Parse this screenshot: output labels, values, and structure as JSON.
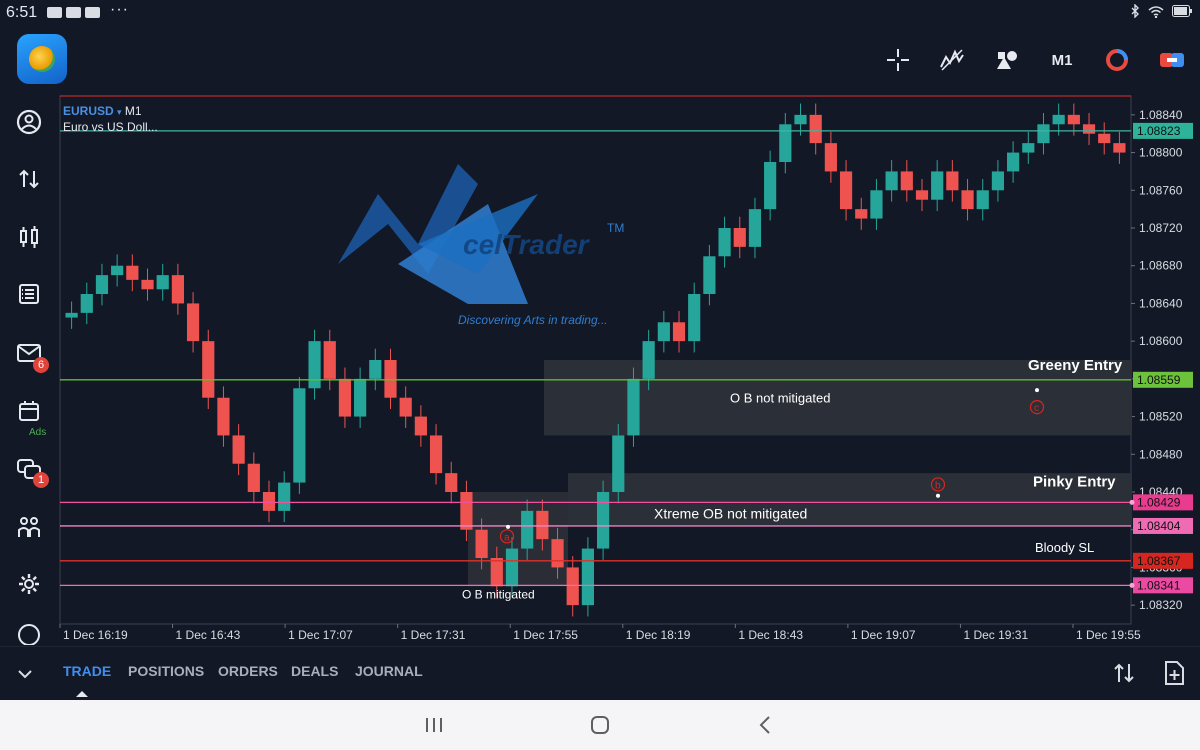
{
  "status_bar": {
    "time": "6:51",
    "dots": "···"
  },
  "toolbar": {
    "timeframe": "M1"
  },
  "sidebar": {
    "mail_badge": "6",
    "chat_badge": "1",
    "ads_label": "Ads"
  },
  "chart": {
    "symbol": "EURUSD",
    "symbol_suffix": "▾",
    "timeframe": "M1",
    "description": "Euro vs US Doll...",
    "watermark": {
      "text": "celTrader",
      "tm": "TM",
      "tagline": "Discovering Arts in trading..."
    },
    "price_labels": [
      "1.08840",
      "1.08800",
      "1.08760",
      "1.08720",
      "1.08680",
      "1.08640",
      "1.08600",
      "1.08560",
      "1.08520",
      "1.08480",
      "1.08440",
      "1.08400",
      "1.08360",
      "1.08320"
    ],
    "time_labels": [
      "1 Dec 16:19",
      "1 Dec 16:43",
      "1 Dec 17:07",
      "1 Dec 17:31",
      "1 Dec 17:55",
      "1 Dec 18:19",
      "1 Dec 18:43",
      "1 Dec 19:07",
      "1 Dec 19:31",
      "1 Dec 19:55"
    ],
    "lines": [
      {
        "name": "current-price",
        "price": "1.08823",
        "color": "#3fb5a0",
        "label_bg": "#2eb39b"
      },
      {
        "name": "greeny-entry",
        "price": "1.08559",
        "color": "#5fbf2c",
        "label_bg": "#6cc23a"
      },
      {
        "name": "line-08429",
        "price": "1.08429",
        "color": "#f24fa0",
        "label_bg": "#e93b8f"
      },
      {
        "name": "line-08404",
        "price": "1.08404",
        "color": "#ef85c4",
        "label_bg": "#ef6cb5"
      },
      {
        "name": "bloody-sl",
        "price": "1.08367",
        "color": "#e0302a",
        "label_bg": "#d7261f"
      },
      {
        "name": "line-08341",
        "price": "1.08341",
        "color": "#f26bb4",
        "label_bg": "#ea4aa2"
      }
    ],
    "annotations": {
      "greeny_entry": "Greeny Entry",
      "pinky_entry": "Pinky Entry",
      "bloody_sl": "Bloody SL",
      "ob_not_mitigated": "O B not mitigated",
      "xtreme_ob": "Xtreme OB not mitigated",
      "ob_mitigated": "O B mitigated",
      "marker_a": "a",
      "marker_b": "b",
      "marker_c": "c"
    }
  },
  "bottom_tabs": [
    "TRADE",
    "POSITIONS",
    "ORDERS",
    "DEALS",
    "JOURNAL"
  ],
  "colors": {
    "bull": "#26a69a",
    "bear": "#ef5350",
    "grid": "#2a2f3d",
    "bg": "#121826",
    "accent": "#3f8ff2"
  },
  "chart_data": {
    "type": "candlestick",
    "ylim": [
      1.083,
      1.0886
    ],
    "xlabels": [
      "1 Dec 16:19",
      "1 Dec 16:43",
      "1 Dec 17:07",
      "1 Dec 17:31",
      "1 Dec 17:55",
      "1 Dec 18:19",
      "1 Dec 18:43",
      "1 Dec 19:07",
      "1 Dec 19:31",
      "1 Dec 19:55"
    ],
    "close": [
      1.0863,
      1.0865,
      1.0867,
      1.0868,
      1.08665,
      1.08655,
      1.0867,
      1.0864,
      1.086,
      1.0854,
      1.085,
      1.0847,
      1.0844,
      1.0842,
      1.0845,
      1.0855,
      1.086,
      1.0856,
      1.0852,
      1.0856,
      1.0858,
      1.0854,
      1.0852,
      1.085,
      1.0846,
      1.0844,
      1.084,
      1.0837,
      1.0834,
      1.0838,
      1.0842,
      1.0839,
      1.0836,
      1.0832,
      1.0838,
      1.0844,
      1.085,
      1.0856,
      1.086,
      1.0862,
      1.086,
      1.0865,
      1.0869,
      1.0872,
      1.087,
      1.0874,
      1.0879,
      1.0883,
      1.0884,
      1.0881,
      1.0878,
      1.0874,
      1.0873,
      1.0876,
      1.0878,
      1.0876,
      1.0875,
      1.0878,
      1.0876,
      1.0874,
      1.0876,
      1.0878,
      1.088,
      1.0881,
      1.0883,
      1.0884,
      1.0883,
      1.0882,
      1.0881,
      1.088
    ]
  }
}
